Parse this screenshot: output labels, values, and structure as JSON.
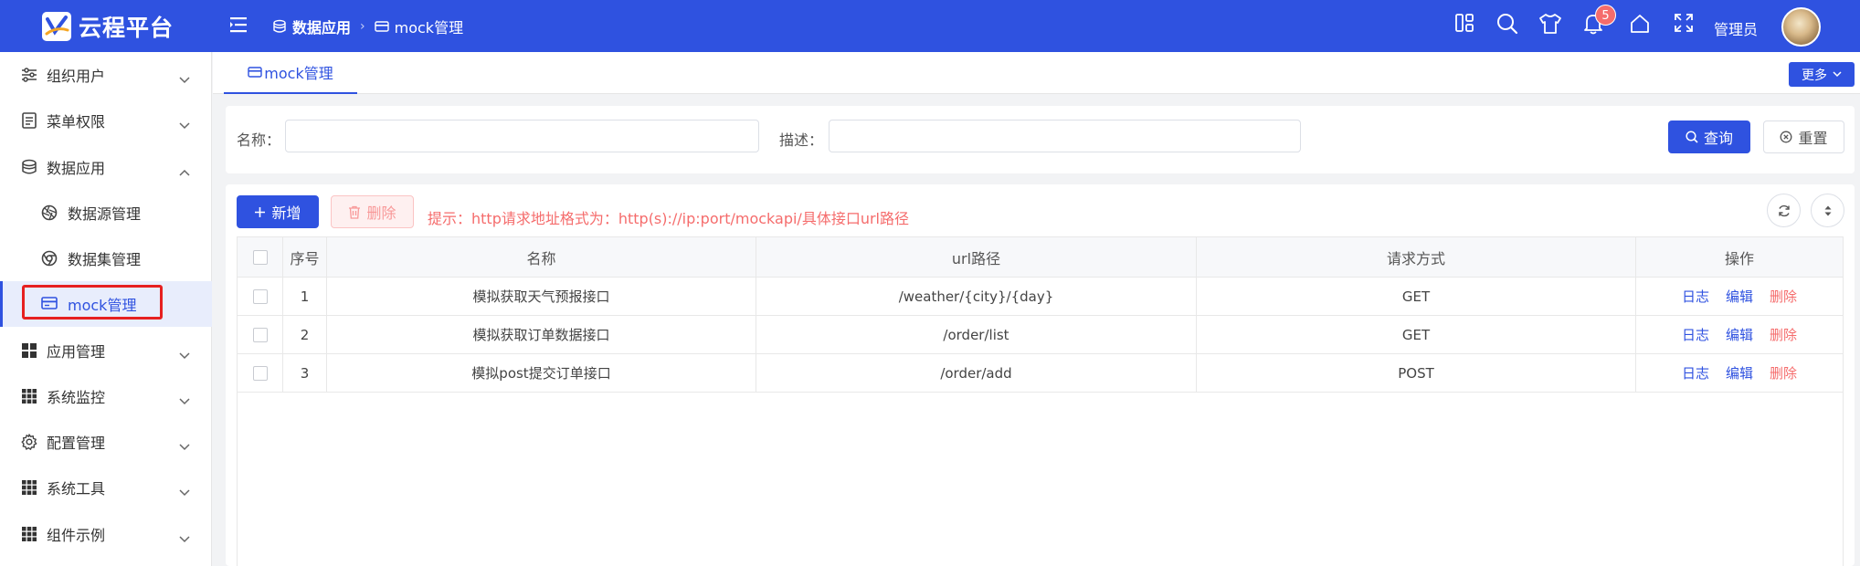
{
  "app": {
    "title": "云程平台"
  },
  "breadcrumb": [
    "数据应用",
    "mock管理"
  ],
  "header": {
    "notification_count": "5",
    "user_name": "管理员",
    "icons": [
      "layout-icon",
      "search-icon",
      "shirt-icon",
      "bell-icon",
      "home-icon",
      "fullscreen-icon"
    ]
  },
  "sidebar": {
    "items": [
      {
        "label": "组织用户",
        "icon": "sliders-icon",
        "expanded": false
      },
      {
        "label": "菜单权限",
        "icon": "document-icon",
        "expanded": false
      },
      {
        "label": "数据应用",
        "icon": "database-icon",
        "expanded": true
      },
      {
        "label": "数据源管理",
        "icon": "aperture-icon",
        "sub": true
      },
      {
        "label": "数据集管理",
        "icon": "chrome-icon",
        "sub": true
      },
      {
        "label": "mock管理",
        "icon": "card-icon",
        "sub": true,
        "active": true
      },
      {
        "label": "应用管理",
        "icon": "grid-icon",
        "expanded": false
      },
      {
        "label": "系统监控",
        "icon": "grid9-icon",
        "expanded": false
      },
      {
        "label": "配置管理",
        "icon": "gear-icon",
        "expanded": false
      },
      {
        "label": "系统工具",
        "icon": "grid9-icon",
        "expanded": false
      },
      {
        "label": "组件示例",
        "icon": "grid9-icon",
        "expanded": false
      }
    ]
  },
  "tabs": [
    {
      "label": "mock管理",
      "active": true
    }
  ],
  "more_label": "更多",
  "search": {
    "name_label": "名称：",
    "name_value": "",
    "desc_label": "描述：",
    "desc_value": "",
    "query_label": "查询",
    "reset_label": "重置"
  },
  "toolbar": {
    "add_label": "新增",
    "delete_label": "删除",
    "tip": "提示：http请求地址格式为：http(s)://ip:port/mockapi/具体接口url路径"
  },
  "table": {
    "columns": [
      "序号",
      "名称",
      "url路径",
      "请求方式",
      "操作"
    ],
    "rows": [
      {
        "index": "1",
        "name": "模拟获取天气预报接口",
        "url": "/weather/{city}/{day}",
        "method": "GET"
      },
      {
        "index": "2",
        "name": "模拟获取订单数据接口",
        "url": "/order/list",
        "method": "GET"
      },
      {
        "index": "3",
        "name": "模拟post提交订单接口",
        "url": "/order/add",
        "method": "POST"
      }
    ],
    "actions": {
      "log": "日志",
      "edit": "编辑",
      "delete": "删除"
    }
  },
  "colors": {
    "primary": "#2f52e0",
    "danger": "#f56c6c",
    "highlight_box": "#e62020"
  }
}
